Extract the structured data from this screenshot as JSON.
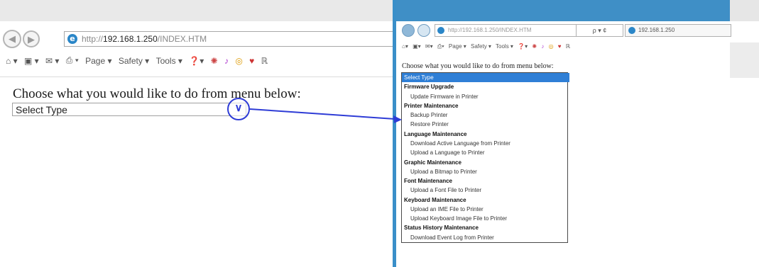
{
  "left": {
    "address": {
      "url_prefix": "http://",
      "host": "192.168.1.250",
      "path": "/INDEX.HTM"
    },
    "commandbar": {
      "page": "Page ▾",
      "safety": "Safety ▾",
      "tools": "Tools ▾"
    },
    "prompt": "Choose what you would like to do from menu below:",
    "select": {
      "value": "Select Type"
    }
  },
  "right": {
    "address": {
      "url": "http://192.168.1.250/INDEX.HTM",
      "controls": "ρ ▾ ¢",
      "tab_title": "192.168.1.250"
    },
    "commandbar": {
      "page": "Page ▾",
      "safety": "Safety ▾",
      "tools": "Tools ▾"
    },
    "prompt": "Choose what you would like to do from menu below:",
    "dropdown": [
      {
        "label": "Select Type",
        "kind": "sel"
      },
      {
        "label": "Firmware Upgrade",
        "kind": "grp"
      },
      {
        "label": "Update Firmware in Printer",
        "kind": "item"
      },
      {
        "label": "Printer Maintenance",
        "kind": "grp"
      },
      {
        "label": "Backup Printer",
        "kind": "item"
      },
      {
        "label": "Restore Printer",
        "kind": "item"
      },
      {
        "label": "Language Maintenance",
        "kind": "grp"
      },
      {
        "label": "Download Active Language from Printer",
        "kind": "item"
      },
      {
        "label": "Upload a Language to Printer",
        "kind": "item"
      },
      {
        "label": "Graphic Maintenance",
        "kind": "grp"
      },
      {
        "label": "Upload a Bitmap to Printer",
        "kind": "item"
      },
      {
        "label": "Font Maintenance",
        "kind": "grp"
      },
      {
        "label": "Upload a Font File to Printer",
        "kind": "item"
      },
      {
        "label": "Keyboard Maintenance",
        "kind": "grp"
      },
      {
        "label": "Upload an IME File to Printer",
        "kind": "item"
      },
      {
        "label": "Upload Keyboard Image File to Printer",
        "kind": "item"
      },
      {
        "label": "Status History Maintenance",
        "kind": "grp"
      },
      {
        "label": "Download Event Log from Printer",
        "kind": "item"
      }
    ]
  },
  "colors": {
    "annotation": "#2e3cd6",
    "accent": "#3f8fc6",
    "selection": "#2f7fd6"
  }
}
